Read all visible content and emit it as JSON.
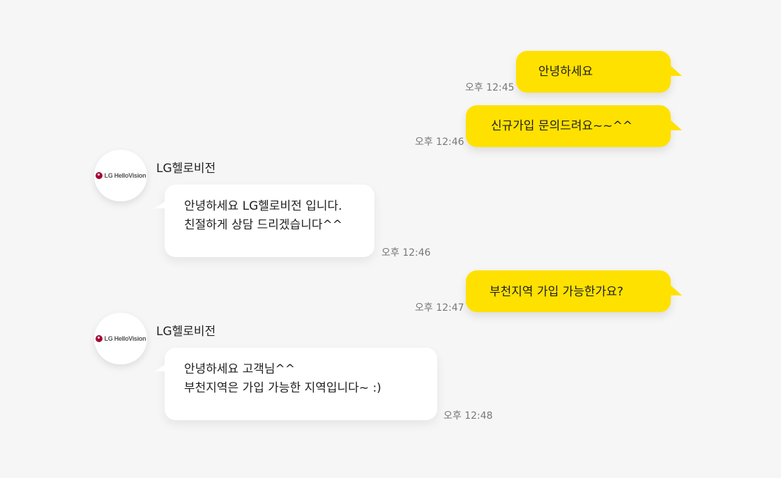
{
  "messages": [
    {
      "type": "out",
      "text": "안녕하세요",
      "time": "오후 12:45"
    },
    {
      "type": "out",
      "text": "신규가입 문의드려요~~^^",
      "time": "오후 12:46"
    },
    {
      "type": "in",
      "sender": "LG헬로비전",
      "lines": [
        "안녕하세요 LG헬로비전 입니다.",
        "친절하게 상담 드리겠습니다^^"
      ],
      "time": "오후 12:46"
    },
    {
      "type": "out",
      "text": "부천지역 가입 가능한가요?",
      "time": "오후 12:47"
    },
    {
      "type": "in",
      "sender": "LG헬로비전",
      "lines": [
        "안녕하세요 고객님^^",
        "부천지역은 가입 가능한 지역입니다~ :)"
      ],
      "time": "오후 12:48"
    }
  ],
  "avatar": {
    "logo_text": "LG HelloVision",
    "icon": "lg-hellovision-logo-icon"
  },
  "colors": {
    "background": "#f6f6f6",
    "outgoing_bubble": "#ffe100",
    "incoming_bubble": "#ffffff",
    "time_text": "#777777"
  }
}
